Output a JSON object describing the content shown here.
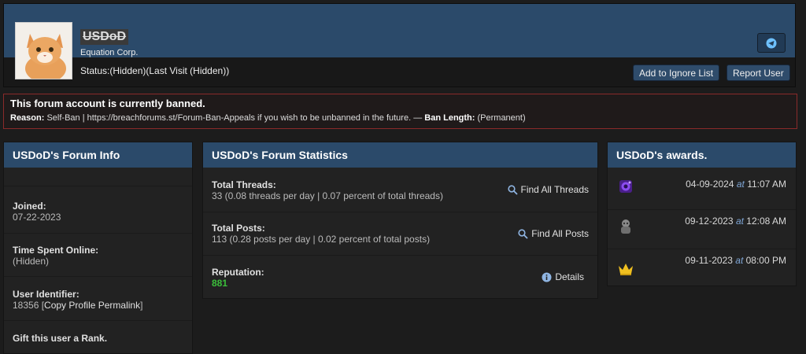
{
  "profile": {
    "username": "USDoD",
    "organization": "Equation Corp.",
    "status": "Status:(Hidden)(Last Visit (Hidden))",
    "ignore_button": "Add to Ignore List",
    "report_button": "Report User",
    "telegram_icon": "telegram-icon"
  },
  "ban": {
    "title": "This forum account is currently banned.",
    "reason_label": "Reason:",
    "reason_text": "Self-Ban | https://breachforums.st/Forum-Ban-Appeals if you wish to be unbanned in the future.",
    "dash": " — ",
    "length_label": "Ban Length:",
    "length_value": "(Permanent)"
  },
  "forum_info": {
    "title": "USDoD's Forum Info",
    "joined_label": "Joined:",
    "joined_value": "07-22-2023",
    "online_label": "Time Spent Online:",
    "online_value": "(Hidden)",
    "uid_label": "User Identifier:",
    "uid_value": "18356",
    "permalink_label": "Copy Profile Permalink",
    "gift_label": "Gift this user a Rank."
  },
  "stats": {
    "title": "USDoD's Forum Statistics",
    "threads_label": "Total Threads:",
    "threads_value": "33 (0.08 threads per day | 0.07 percent of total threads)",
    "threads_link": "Find All Threads",
    "posts_label": "Total Posts:",
    "posts_value": "113 (0.28 posts per day | 0.02 percent of total posts)",
    "posts_link": "Find All Posts",
    "rep_label": "Reputation:",
    "rep_value": "881",
    "rep_link": "Details"
  },
  "awards": {
    "title": "USDoD's awards.",
    "items": [
      {
        "icon": "purple-speaker-icon",
        "date": "04-09-2024",
        "at": "at",
        "time": "11:07 AM"
      },
      {
        "icon": "grey-robot-icon",
        "date": "09-12-2023",
        "at": "at",
        "time": "12:08 AM"
      },
      {
        "icon": "gold-crown-icon",
        "date": "09-11-2023",
        "at": "at",
        "time": "08:00 PM"
      }
    ]
  },
  "colors": {
    "header_blue": "#2b4a6a",
    "reputation_green": "#3bbf3b",
    "ban_border": "#8a2a2a"
  }
}
